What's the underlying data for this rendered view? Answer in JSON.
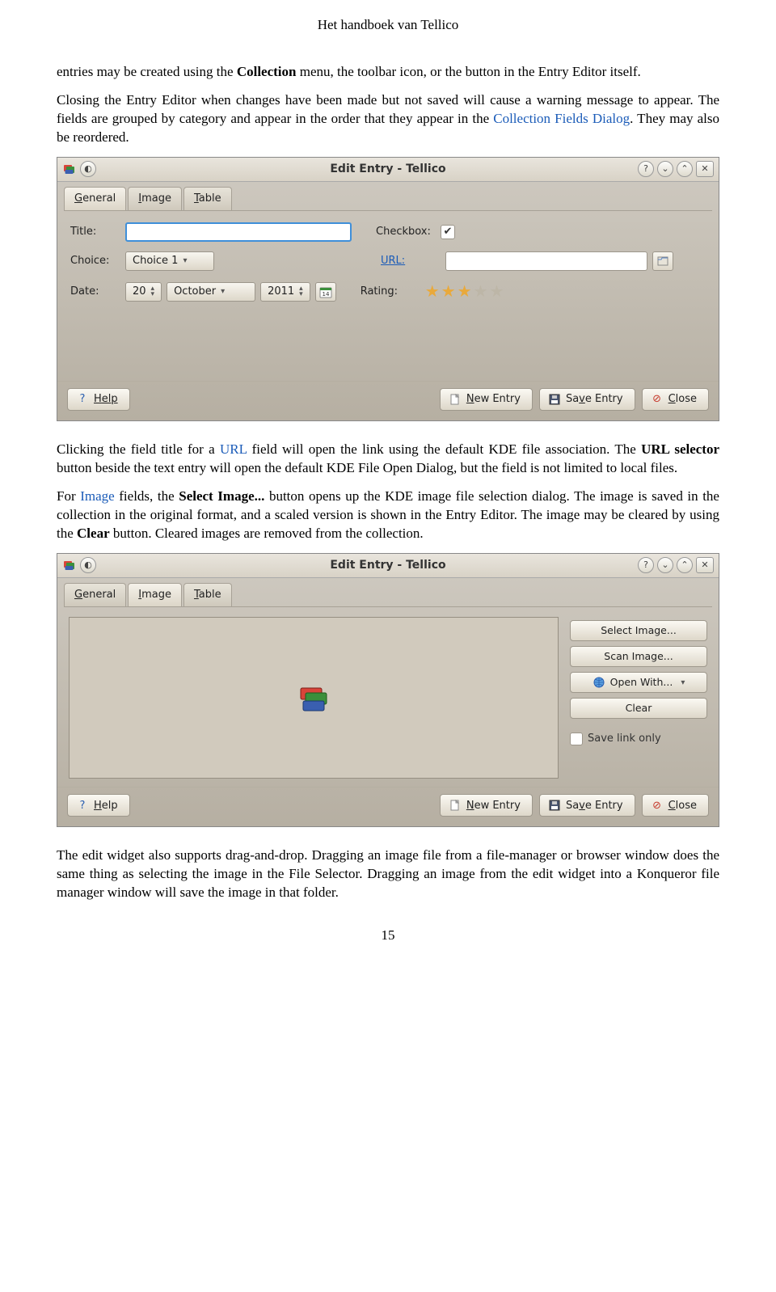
{
  "doc_title": "Het handboek van Tellico",
  "page_number": "15",
  "para1a": "entries may be created using the ",
  "para1b": "Collection",
  "para1c": " menu, the toolbar icon, or the button in the Entry Editor itself.",
  "para2a": "Closing the Entry Editor when changes have been made but not saved will cause a warning message to appear. The fields are grouped by category and appear in the order that they appear in the ",
  "para2b": "Collection Fields Dialog",
  "para2c": ". They may also be reordered.",
  "para3a": "Clicking the field title for a ",
  "para3b": "URL",
  "para3c": " field will open the link using the default KDE file association. The ",
  "para3d": "URL selector",
  "para3e": " button beside the text entry will open the default KDE File Open Dialog, but the field is not limited to local files.",
  "para4a": "For ",
  "para4b": "Image",
  "para4c": " fields, the ",
  "para4d": "Select Image...",
  "para4e": " button opens up the KDE image file selection dialog. The image is saved in the collection in the original format, and a scaled version is shown in the Entry Editor. The image may be cleared by using the ",
  "para4f": "Clear",
  "para4g": " button. Cleared images are removed from the collection.",
  "para5": "The edit widget also supports drag-and-drop. Dragging an image file from a file-manager or browser window does the same thing as selecting the image in the File Selector. Dragging an image from the edit widget into a Konqueror file manager window will save the image in that folder.",
  "win": {
    "title": "Edit Entry - Tellico",
    "tabs": {
      "general": "General",
      "image": "Image",
      "table": "Table"
    },
    "labels": {
      "title": "Title:",
      "choice": "Choice:",
      "date": "Date:",
      "checkbox": "Checkbox:",
      "url": "URL:",
      "rating": "Rating:"
    },
    "values": {
      "choice": "Choice 1",
      "day": "20",
      "month": "October",
      "year": "2011",
      "cal": "14"
    },
    "buttons": {
      "help": "Help",
      "new": "New Entry",
      "save": "Save Entry",
      "close": "Close"
    }
  },
  "imgwin": {
    "buttons": {
      "select": "Select Image...",
      "scan": "Scan Image...",
      "open": "Open With...",
      "clear": "Clear"
    },
    "savelink": "Save link only"
  }
}
